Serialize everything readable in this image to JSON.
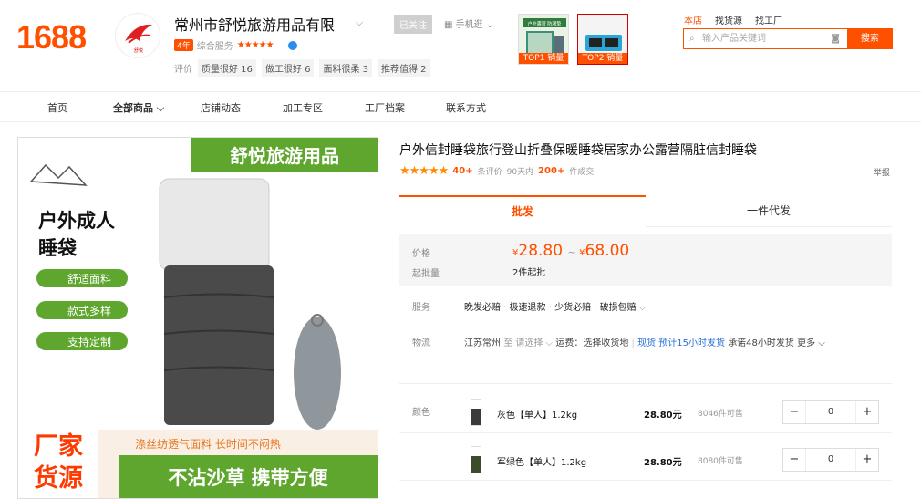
{
  "header": {
    "logo": "1688",
    "shop_name": "常州市舒悦旅游用品有限",
    "years_badge": "4年",
    "composite_label": "综合服务",
    "composite_stars": "★★★★★",
    "review_label": "评价",
    "tags": [
      "质量很好 16",
      "做工很好 6",
      "面料很柔 3",
      "推荐值得 2"
    ],
    "follow_label": "已关注",
    "mobile_label": "手机逛",
    "top1_label": "TOP1 销量",
    "top2_label": "TOP2 销量",
    "top1_img_text": "户外露营 防潮垫",
    "search_tabs": [
      "本店",
      "找货源",
      "找工厂"
    ],
    "search_placeholder": "输入产品关键词",
    "search_button": "搜索",
    "shop_logo_text": "舒悦"
  },
  "nav": [
    "首页",
    "全部商品",
    "店铺动态",
    "加工专区",
    "工厂档案",
    "联系方式"
  ],
  "hero": {
    "banner": "舒悦旅游用品",
    "headline1": "户外成人",
    "headline2": "睡袋",
    "pills": [
      "舒适面料",
      "款式多样",
      "支持定制"
    ],
    "strip": "涤丝纺透气面料 长时间不闷热",
    "bottom": "不沾沙草 携带方便",
    "corner1": "厂家",
    "corner2": "货源"
  },
  "product": {
    "title": "户外信封睡袋旅行登山折叠保暖睡袋居家办公露营隔脏信封睡袋",
    "stars": "★★★★★",
    "reviews": "40+",
    "reviews_label": "条评价",
    "ninety_label": "90天内",
    "sold": "200+",
    "sold_label": "件成交",
    "report": "举报",
    "tab_wholesale": "批发",
    "tab_dropship": "一件代发",
    "price_label": "价格",
    "moq_label": "起批量",
    "price_low": "28.80",
    "price_high": "68.00",
    "currency": "¥",
    "moq": "2件起批",
    "service_label": "服务",
    "service": "晚发必赔 · 极速退款 · 少货必赔 · 破损包赔",
    "logistics_label": "物流",
    "from": "江苏常州",
    "to_label": "至",
    "select": "请选择",
    "freight": "运费：选择收货地",
    "instock": "现货",
    "ship_pred": "预计15小时发货",
    "promise": "承诺48小时发货",
    "more": "更多",
    "color_label": "颜色",
    "skus": [
      {
        "name": "灰色【单人】1.2kg",
        "price": "28.80元",
        "stock": "8046件可售",
        "qty": "0",
        "color": "#3a3a3a"
      },
      {
        "name": "军绿色【单人】1.2kg",
        "price": "28.80元",
        "stock": "8080件可售",
        "qty": "0",
        "color": "#3d4a2c"
      }
    ]
  },
  "colors": {
    "accent": "#ff5000",
    "green": "#5ea62e",
    "blue": "#2a6fd6"
  }
}
